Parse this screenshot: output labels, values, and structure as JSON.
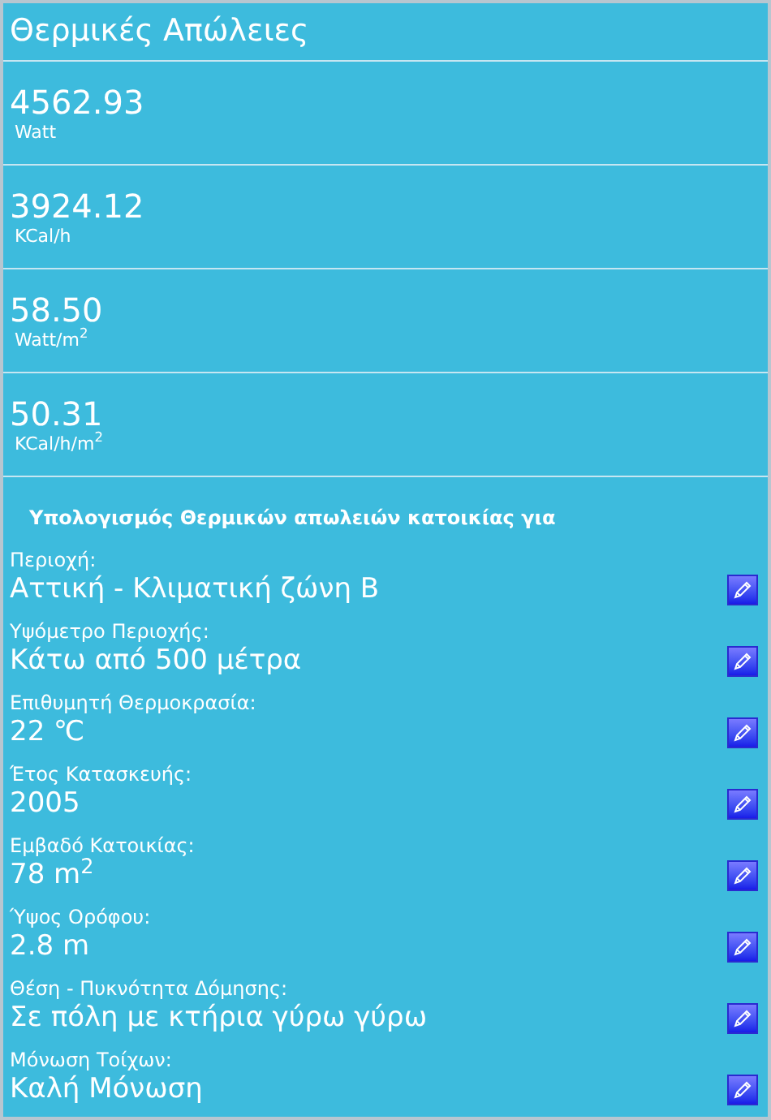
{
  "title": "Θερμικές Απώλειες",
  "results": [
    {
      "value": "4562.93",
      "unit": "Watt"
    },
    {
      "value": "3924.12",
      "unit": "KCal/h"
    },
    {
      "value": "58.50",
      "unit": "Watt/m$^{2}$"
    },
    {
      "value": "50.31",
      "unit": "KCal/h/m$^{2}$"
    }
  ],
  "section_heading": "Υπολογισμός Θερμικών απωλειών κατοικίας για",
  "parameters": [
    {
      "label": "Περιοχή:",
      "value": "Αττική - Κλιματική ζώνη Β"
    },
    {
      "label": "Υψόμετρο Περιοχής:",
      "value": "Κάτω από 500 μέτρα"
    },
    {
      "label": "Επιθυμητή Θερμοκρασία:",
      "value": "22 ℃"
    },
    {
      "label": "Έτος Κατασκευής:",
      "value": "2005"
    },
    {
      "label": "Εμβαδό Κατοικίας:",
      "value": "78 m$^{2}$"
    },
    {
      "label": "Ύψος Ορόφου:",
      "value": "2.8 m"
    },
    {
      "label": "Θέση - Πυκνότητα Δόμησης:",
      "value": "Σε πόλη με κτήρια γύρω γύρω"
    },
    {
      "label": "Μόνωση Τοίχων:",
      "value": "Καλή Μόνωση"
    }
  ]
}
